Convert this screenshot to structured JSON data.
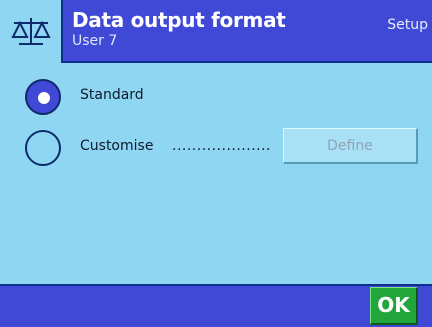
{
  "header": {
    "title": "Data output format",
    "subtitle": "User 7",
    "mode": "Setup",
    "icon": "balance-icon"
  },
  "options": [
    {
      "label": "Standard",
      "selected": true
    },
    {
      "label": "Customise",
      "dots": "....................",
      "selected": false
    }
  ],
  "buttons": {
    "define_label": "Define",
    "ok_label": "OK"
  },
  "colors": {
    "background": "#8fd6f2",
    "bar": "#3f49d6",
    "ok": "#22a63c"
  }
}
